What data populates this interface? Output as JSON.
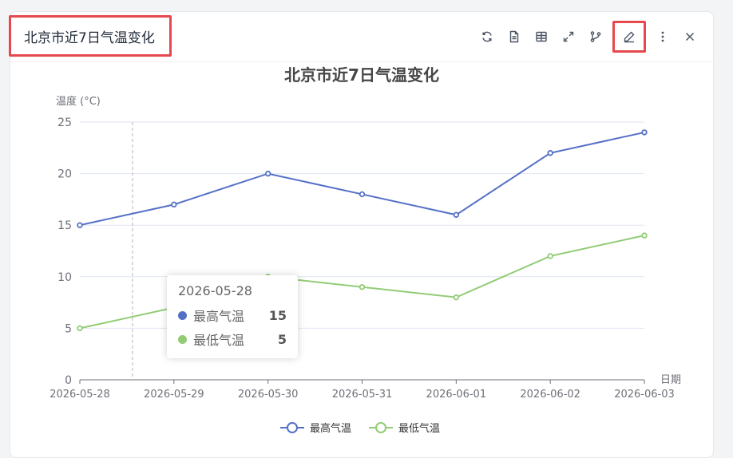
{
  "header": {
    "title": "北京市近7日气温变化"
  },
  "toolbar": [
    {
      "name": "refresh-icon"
    },
    {
      "name": "document-icon"
    },
    {
      "name": "table-icon"
    },
    {
      "name": "expand-icon"
    },
    {
      "name": "branch-icon"
    },
    {
      "name": "edit-icon",
      "highlighted": true
    },
    {
      "name": "more-vertical-icon"
    },
    {
      "name": "close-icon"
    }
  ],
  "colors": {
    "max": "#5470c6",
    "min": "#91cc75",
    "highlight": "#e5484d"
  },
  "tooltip": {
    "title": "2026-05-28",
    "rows": [
      {
        "name": "最高气温",
        "value": "15"
      },
      {
        "name": "最低气温",
        "value": "5"
      }
    ]
  },
  "chart_data": {
    "type": "line",
    "title": "北京市近7日气温变化",
    "ylabel": "温度 (°C)",
    "xlabel": "日期",
    "categories": [
      "2026-05-28",
      "2026-05-29",
      "2026-05-30",
      "2026-05-31",
      "2026-06-01",
      "2026-06-02",
      "2026-06-03"
    ],
    "ylim": [
      0,
      25
    ],
    "yticks": [
      0,
      5,
      10,
      15,
      20,
      25
    ],
    "grid": true,
    "legend_position": "bottom",
    "series": [
      {
        "name": "最高气温",
        "values": [
          15,
          17,
          20,
          18,
          16,
          22,
          24
        ]
      },
      {
        "name": "最低气温",
        "values": [
          5,
          7,
          10,
          9,
          8,
          12,
          14
        ]
      }
    ]
  }
}
